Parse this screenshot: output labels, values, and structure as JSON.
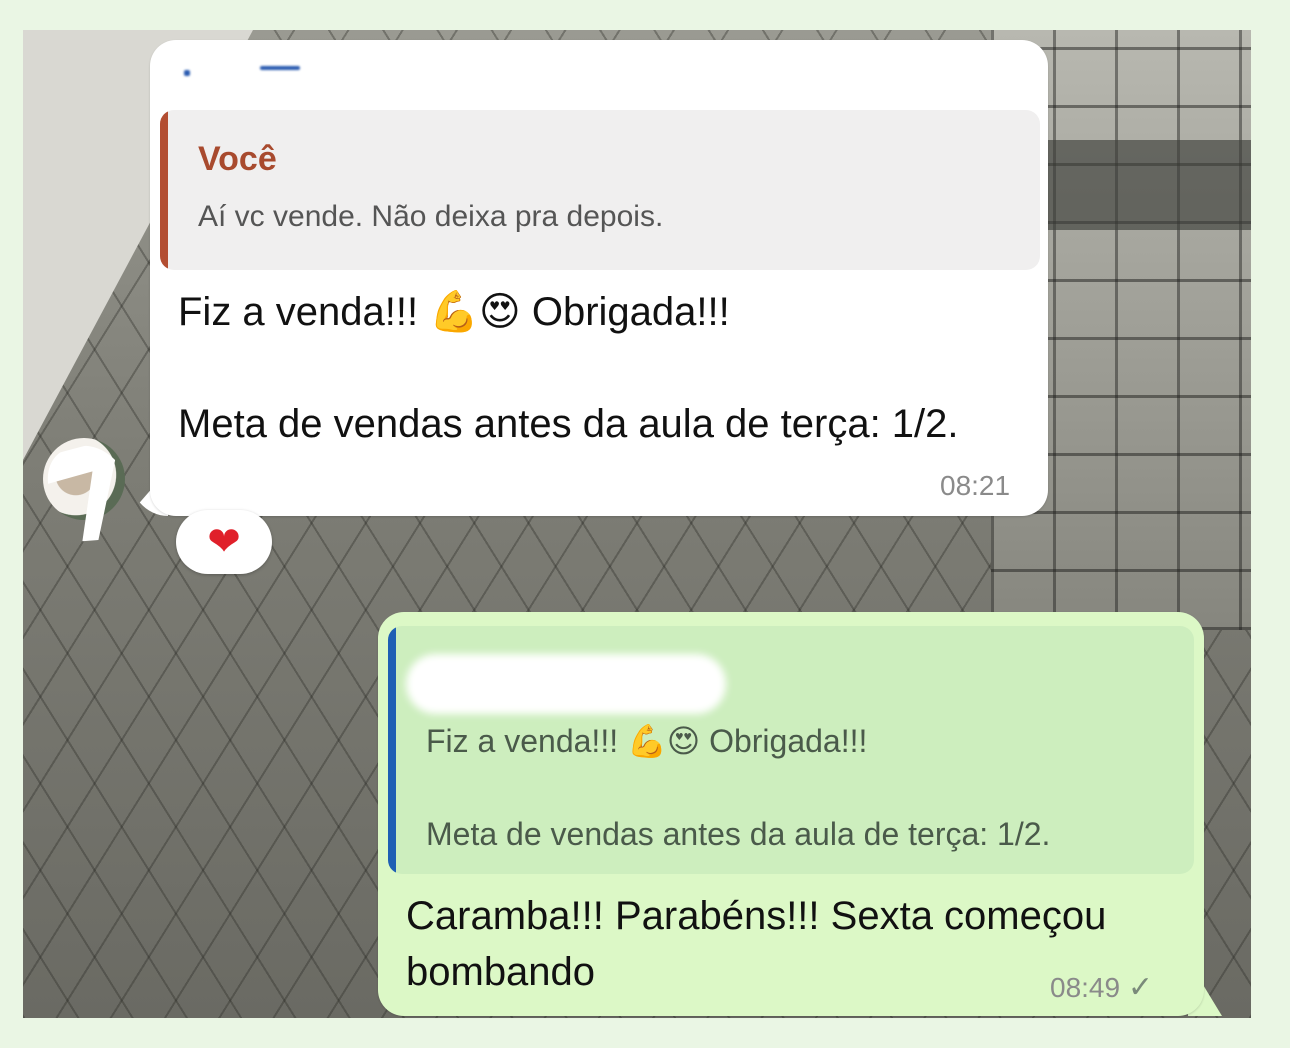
{
  "incoming": {
    "quoted": {
      "author": "Você",
      "text": "Aí vc vende. Não deixa pra depois."
    },
    "line1_text": "Fiz a venda!!! ",
    "line1_emoji": "💪😍",
    "line1_end": " Obrigada!!!",
    "line2": "Meta de vendas antes da aula de terça: 1/2.",
    "time": "08:21",
    "reaction": "❤"
  },
  "outgoing": {
    "quoted": {
      "line1_text": "Fiz a venda!!! ",
      "line1_emoji": "💪😍",
      "line1_end": " Obrigada!!!",
      "line2": "Meta de vendas antes da aula de terça: 1/2."
    },
    "line1": "Caramba!!! Parabéns!!! Sexta começou",
    "line2": "bombando",
    "time": "08:49",
    "status_icon": "✓"
  },
  "colors": {
    "incoming_bubble": "#ffffff",
    "outgoing_bubble": "#dcf8c6",
    "quote_author": "#a84a2e",
    "quote_bar_out": "#1f5fb4",
    "reaction_heart": "#e0202a"
  }
}
